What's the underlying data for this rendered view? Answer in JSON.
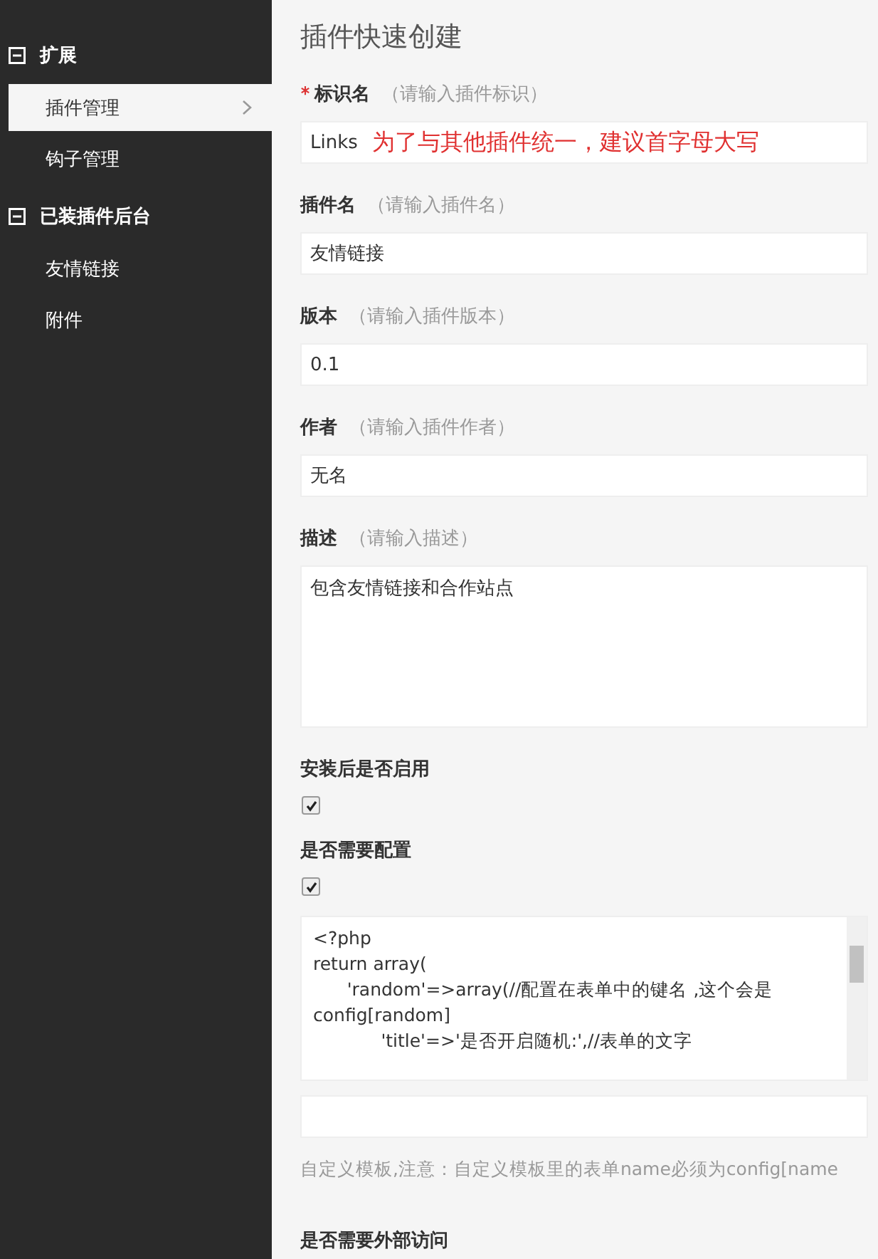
{
  "sidebar": {
    "sections": [
      {
        "title": "扩展",
        "expanded": true,
        "items": [
          {
            "label": "插件管理",
            "selected": true
          },
          {
            "label": "钩子管理",
            "selected": false
          }
        ]
      },
      {
        "title": "已装插件后台",
        "expanded": true,
        "items": [
          {
            "label": "友情链接",
            "selected": false
          },
          {
            "label": "附件",
            "selected": false
          }
        ]
      }
    ]
  },
  "form": {
    "title": "插件快速创建",
    "fields": [
      {
        "kind": "text",
        "label": "标识名",
        "required": true,
        "hint": "（请输入插件标识）",
        "value": "Links",
        "annotation": "为了与其他插件统一，建议首字母大写"
      },
      {
        "kind": "text",
        "label": "插件名",
        "hint": "（请输入插件名）",
        "value": "友情链接"
      },
      {
        "kind": "text",
        "label": "版本",
        "hint": "（请输入插件版本）",
        "value": "0.1"
      },
      {
        "kind": "text",
        "label": "作者",
        "hint": "（请输入插件作者）",
        "value": "无名"
      },
      {
        "kind": "textarea",
        "label": "描述",
        "hint": "（请输入描述）",
        "value": "包含友情链接和合作站点"
      },
      {
        "kind": "checkbox",
        "label": "安装后是否启用",
        "checked": true
      },
      {
        "kind": "checkbox",
        "label": "是否需要配置",
        "checked": true
      },
      {
        "kind": "code",
        "value": "<?php\nreturn array(\n\t'random'=>array(//配置在表单中的键名 ,这个会是config[random]\n\t\t'title'=>'是否开启随机:',//表单的文字"
      },
      {
        "kind": "text"
      },
      {
        "kind": "note",
        "text": "自定义模板,注意：自定义模板里的表单name必须为config[name"
      },
      {
        "kind": "heading",
        "label": "是否需要外部访问"
      }
    ]
  }
}
